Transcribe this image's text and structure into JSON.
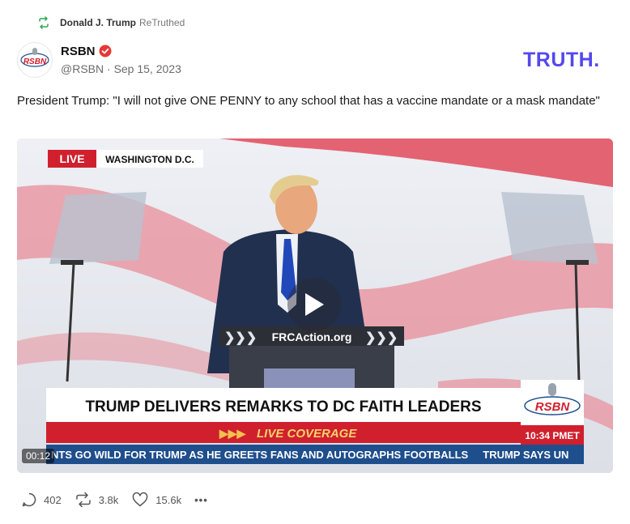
{
  "retruth": {
    "name": "Donald J. Trump",
    "label": "ReTruthed"
  },
  "author": {
    "avatar_text": "RSBN",
    "name": "RSBN",
    "handle": "@RSBN",
    "separator": "·",
    "date": "Sep 15, 2023"
  },
  "logo": {
    "text": "TRUTH.",
    "color": "#5448ee"
  },
  "post": {
    "text": "President Trump: \"I will not give ONE PENNY to any school that has a vaccine mandate or a mask mandate\""
  },
  "video": {
    "time": "00:12",
    "live_badge": "LIVE",
    "location": "WASHINGTON D.C.",
    "podium_text": "FRCAction.org",
    "headline": "TRUMP DELIVERS REMARKS TO DC FAITH LEADERS",
    "live_coverage": "LIVE COVERAGE",
    "ticker": "NTS GO WILD FOR TRUMP AS HE GREETS FANS AND AUTOGRAPHS FOOTBALLS     TRUMP SAYS UN",
    "channel_logo": "RSBN",
    "clock": "10:34 PMET"
  },
  "actions": {
    "replies": "402",
    "retruths": "3.8k",
    "likes": "15.6k",
    "more": "•••"
  },
  "colors": {
    "brand": "#5448ee",
    "verified": "#e53935",
    "live_red": "#d0202e",
    "ticker_blue": "#1f4e8c"
  }
}
